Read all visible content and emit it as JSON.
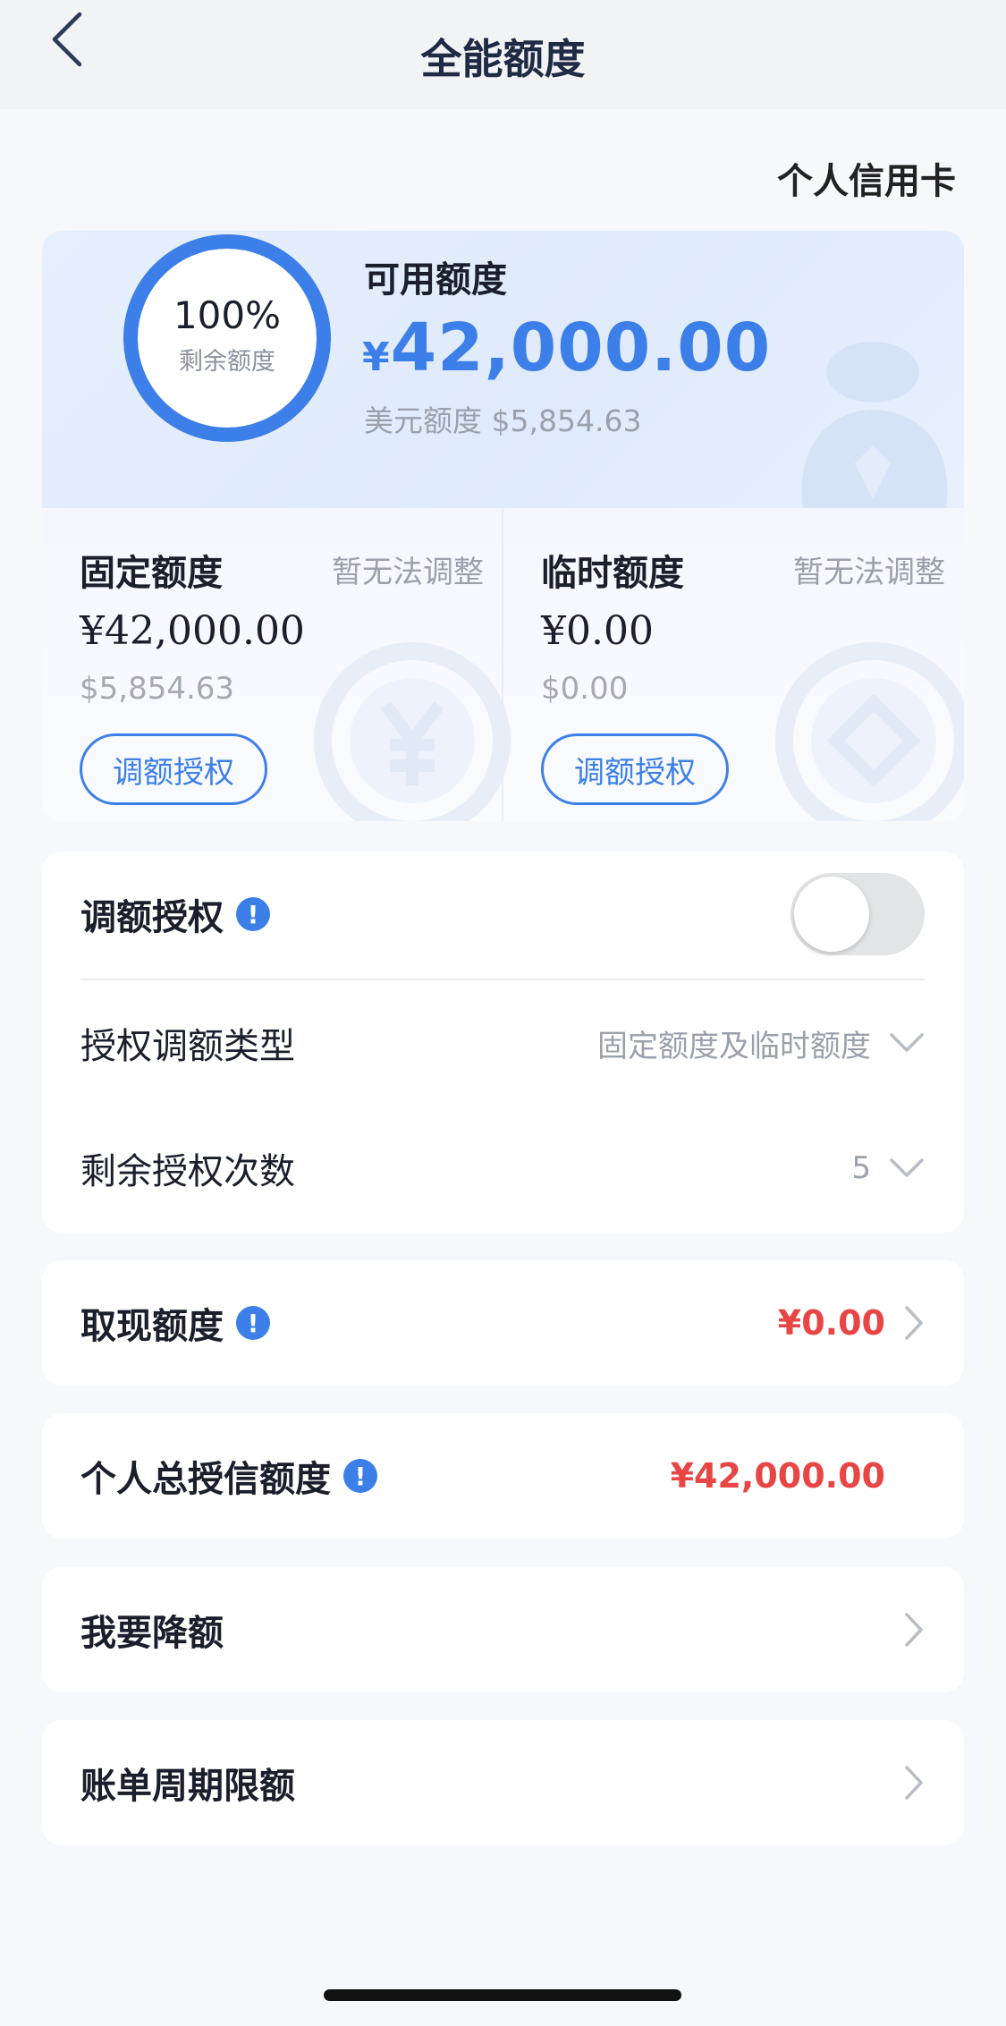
{
  "header": {
    "title": "全能额度"
  },
  "card_type": "个人信用卡",
  "summary": {
    "ring_percent": "100%",
    "ring_fraction": 1.0,
    "ring_label": "剩余额度",
    "available_label": "可用额度",
    "currency_symbol": "¥",
    "available_amount": "42,000.00",
    "usd_line": "美元额度 $5,854.63"
  },
  "fixed_limit": {
    "title": "固定额度",
    "note": "暂无法调整",
    "amount": "¥42,000.00",
    "usd": "$5,854.63",
    "button_label": "调额授权"
  },
  "temp_limit": {
    "title": "临时额度",
    "note": "暂无法调整",
    "amount": "¥0.00",
    "usd": "$0.00",
    "button_label": "调额授权"
  },
  "auth_section": {
    "toggle_label": "调额授权",
    "toggle_on": false,
    "type_label": "授权调额类型",
    "type_value": "固定额度及临时额度",
    "count_label": "剩余授权次数",
    "count_value": "5"
  },
  "cash_limit": {
    "label": "取现额度",
    "value": "¥0.00"
  },
  "total_credit": {
    "label": "个人总授信额度",
    "value": "¥42,000.00"
  },
  "reduce_limit": {
    "label": "我要降额"
  },
  "cycle_limit": {
    "label": "账单周期限额"
  },
  "colors": {
    "accent": "#3d7fe8",
    "highlight_red": "#e84545",
    "text_primary": "#1a1f2b",
    "text_secondary": "#9ba1ab"
  },
  "icons": {
    "back": "chevron-left-icon",
    "info": "info-icon",
    "chevron_down": "chevron-down-icon",
    "chevron_right": "chevron-right-icon"
  }
}
